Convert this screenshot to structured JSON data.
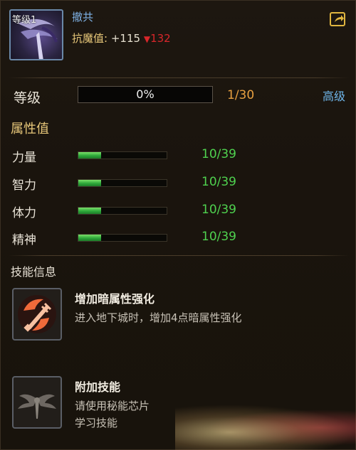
{
  "header": {
    "level_badge": "等级1",
    "item_name": "撤共",
    "resist_label": "抗魔值:",
    "resist_value": "+115",
    "resist_down_value": "132"
  },
  "level": {
    "label": "等级",
    "progress_text": "0%",
    "progress_fraction": 0.0,
    "count": "1/30",
    "advanced_label": "高级"
  },
  "attributes": {
    "heading": "属性值",
    "items": [
      {
        "name": "力量",
        "value": "10/39",
        "fill": 0.2564
      },
      {
        "name": "智力",
        "value": "10/39",
        "fill": 0.2564
      },
      {
        "name": "体力",
        "value": "10/39",
        "fill": 0.2564
      },
      {
        "name": "精神",
        "value": "10/39",
        "fill": 0.2564
      }
    ]
  },
  "skills": {
    "heading": "技能信息",
    "items": [
      {
        "name": "增加暗属性强化",
        "desc_1": "进入地下城时，增加4点暗属性强化",
        "desc_2": ""
      },
      {
        "name": "附加技能",
        "desc_1": "请使用秘能芯片",
        "desc_2": "学习技能"
      }
    ]
  },
  "colors": {
    "accent_gold": "#e8c87a",
    "accent_blue": "#6fb6ea",
    "value_green": "#4fd24f",
    "down_red": "#d8262a",
    "count_orange": "#e8a040"
  },
  "icons": {
    "share": "share-export-icon",
    "avatar": "scythe-weapon-icon",
    "skill_1": "dark-sword-flame-icon",
    "skill_2": "winged-emblem-icon",
    "down": "red-down-triangle-icon"
  }
}
